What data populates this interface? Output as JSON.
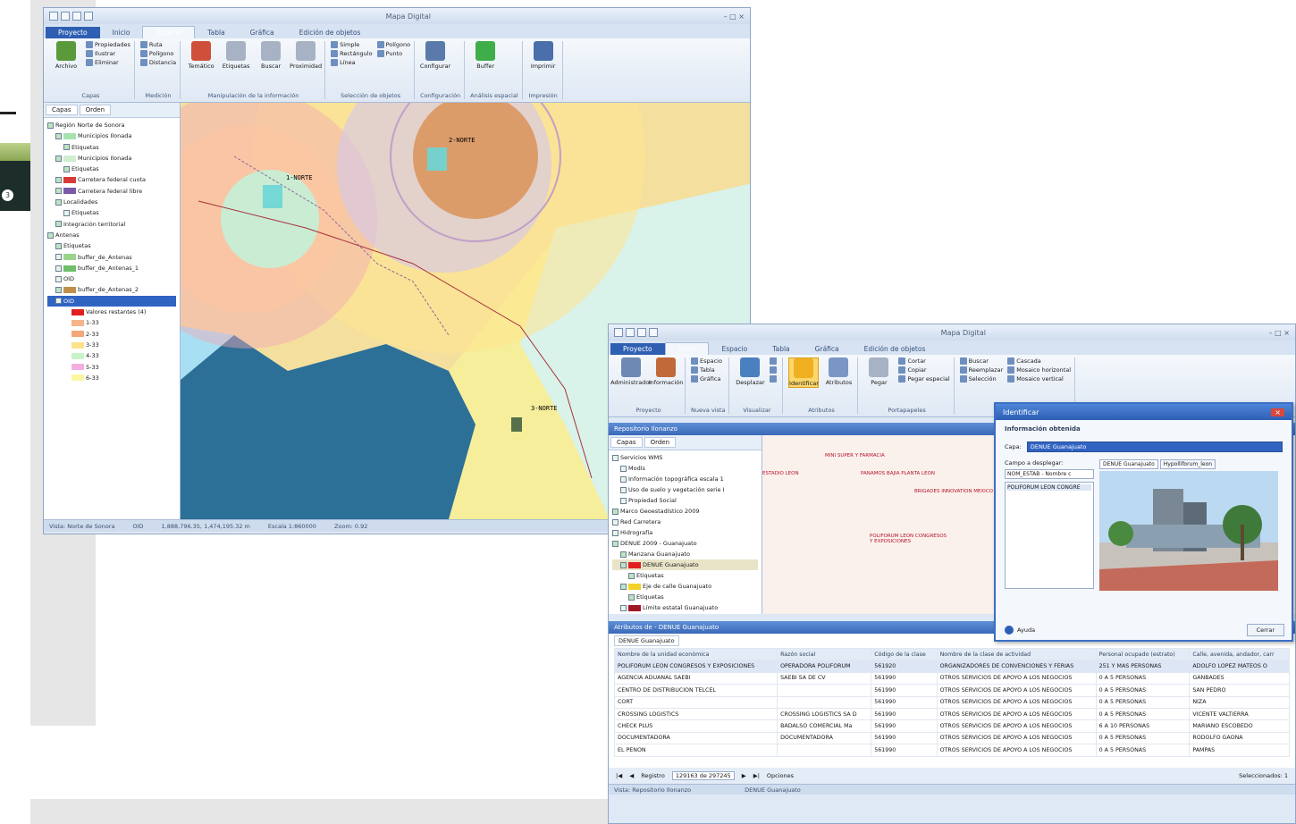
{
  "slide": {
    "badge": "3"
  },
  "win1": {
    "title": "Mapa Digital",
    "tabs": [
      "Proyecto",
      "Inicio",
      "Espacio",
      "Tabla",
      "Gráfica",
      "Edición de objetos"
    ],
    "groups": [
      {
        "label": "Capas",
        "items": [
          {
            "label": "Archivo",
            "kind": "big",
            "color": "#5a9a3a"
          },
          {
            "kind": "small",
            "list": [
              "Propiedades",
              "Ilustrar",
              "Eliminar"
            ]
          }
        ]
      },
      {
        "label": "Medición",
        "items": [
          {
            "kind": "small",
            "list": [
              "Ruta",
              "Polígono",
              "Distancia"
            ]
          }
        ]
      },
      {
        "label": "Manipulación de la información",
        "items": [
          {
            "label": "Temático",
            "kind": "big",
            "color": "#d04f3a"
          },
          {
            "label": "Etiquetas",
            "kind": "big",
            "color": "#a7b3c4"
          },
          {
            "label": "Buscar",
            "kind": "big",
            "color": "#a7b3c4"
          },
          {
            "label": "Proximidad",
            "kind": "big",
            "color": "#a7b3c4"
          }
        ]
      },
      {
        "label": "Selección de objetos",
        "items": [
          {
            "kind": "small",
            "list": [
              "Simple",
              "Rectángulo",
              "Línea"
            ]
          },
          {
            "kind": "small",
            "list": [
              "Polígono",
              "Punto"
            ]
          }
        ]
      },
      {
        "label": "Configuración",
        "items": [
          {
            "label": "Configurar",
            "kind": "big",
            "color": "#5a7aaa"
          }
        ]
      },
      {
        "label": "Análisis espacial",
        "items": [
          {
            "label": "Buffer",
            "kind": "big",
            "color": "#3fae4a"
          }
        ]
      },
      {
        "label": "Impresión",
        "items": [
          {
            "label": "Imprimir",
            "kind": "big",
            "color": "#4a6faa"
          }
        ]
      }
    ],
    "sidetabs": [
      "Capas",
      "Orden"
    ],
    "tree": [
      {
        "label": "Región Norte de Sonora",
        "indent": 0,
        "check": true
      },
      {
        "label": "Municipios Ilonada",
        "indent": 1,
        "check": true,
        "swatch": "#a7e3b0"
      },
      {
        "label": "Etiquetas",
        "indent": 2,
        "check": true
      },
      {
        "label": "Municipios Ilonada",
        "indent": 1,
        "check": true,
        "swatch": "#cfeed0"
      },
      {
        "label": "Etiquetas",
        "indent": 2,
        "check": true
      },
      {
        "label": "Carretera federal cuota",
        "indent": 1,
        "check": true,
        "swatch": "#d83a3a"
      },
      {
        "label": "Carretera federal libre",
        "indent": 1,
        "check": true,
        "swatch": "#7a5aa8"
      },
      {
        "label": "Localidades",
        "indent": 1,
        "check": true
      },
      {
        "label": "Etiquetas",
        "indent": 2,
        "check": false
      },
      {
        "label": "Integración territorial",
        "indent": 1,
        "check": true
      },
      {
        "label": "Antenas",
        "indent": 0,
        "check": true
      },
      {
        "label": "Etiquetas",
        "indent": 1,
        "check": true
      },
      {
        "label": "buffer_de_Antenas",
        "indent": 1,
        "check": false,
        "swatch": "#9bd48a"
      },
      {
        "label": "buffer_de_Antenas_1",
        "indent": 1,
        "check": false,
        "swatch": "#6fbf6a"
      },
      {
        "label": "OID",
        "indent": 1,
        "check": false
      },
      {
        "label": "buffer_de_Antenas_2",
        "indent": 1,
        "check": true,
        "swatch": "#c0904a"
      },
      {
        "label": "OID",
        "indent": 1,
        "check": false,
        "selected": true
      },
      {
        "label": "Valores restantes (4)",
        "indent": 3,
        "swatch": "#e02020"
      },
      {
        "label": "1-33",
        "indent": 3,
        "swatch": "#f7b38a"
      },
      {
        "label": "2-33",
        "indent": 3,
        "swatch": "#f4a87a"
      },
      {
        "label": "3-33",
        "indent": 3,
        "swatch": "#fde28a"
      },
      {
        "label": "4-33",
        "indent": 3,
        "swatch": "#c8f2c8"
      },
      {
        "label": "5-33",
        "indent": 3,
        "swatch": "#f2b0e0"
      },
      {
        "label": "6-33",
        "indent": 3,
        "swatch": "#fbf6a0"
      }
    ],
    "labels": [
      "1-NORTE",
      "2-NORTE",
      "3-NORTE"
    ],
    "status": [
      "Vista: Norte de Sonora",
      "OID",
      "1,888,796.35, 1,474,195.32 m",
      "Escala 1:860000",
      "Zoom: 0.92"
    ]
  },
  "win2": {
    "title": "Mapa Digital",
    "tabs": [
      "Proyecto",
      "Inicio",
      "Espacio",
      "Tabla",
      "Gráfica",
      "Edición de objetos"
    ],
    "groups": [
      {
        "label": "Proyecto",
        "items": [
          {
            "label": "Administrador",
            "kind": "big",
            "color": "#6f89b5"
          },
          {
            "label": "Información",
            "kind": "big",
            "color": "#c06a3a"
          }
        ]
      },
      {
        "label": "Nueva vista",
        "items": [
          {
            "kind": "small",
            "list": [
              "Espacio",
              "Tabla",
              "Gráfica"
            ]
          }
        ]
      },
      {
        "label": "Visualizar",
        "items": [
          {
            "label": "Desplazar",
            "kind": "big",
            "color": "#4a7fc0"
          },
          {
            "kind": "small",
            "list": [
              "",
              "",
              ""
            ]
          }
        ]
      },
      {
        "label": "Atributos",
        "items": [
          {
            "label": "Identificar",
            "kind": "big",
            "color": "#f0b020",
            "active": true
          },
          {
            "label": "Atributos",
            "kind": "big",
            "color": "#7a96c4"
          }
        ]
      },
      {
        "label": "Portapapeles",
        "items": [
          {
            "label": "Pegar",
            "kind": "big",
            "color": "#a7b3c4"
          },
          {
            "kind": "small",
            "list": [
              "Cortar",
              "Copiar",
              "Pegar especial"
            ]
          }
        ]
      },
      {
        "label": "",
        "items": [
          {
            "kind": "small",
            "list": [
              "Buscar",
              "Reemplazar",
              "Selección"
            ]
          },
          {
            "kind": "small",
            "list": [
              "Cascada",
              "Mosaico horizontal",
              "Mosaico vertical"
            ]
          }
        ]
      }
    ],
    "panel_title": "Repositorio Ilonanzo",
    "sidetabs": [
      "Capas",
      "Orden"
    ],
    "tree": [
      {
        "label": "Servicios WMS",
        "indent": 0,
        "check": false
      },
      {
        "label": "Modis",
        "indent": 1,
        "check": false
      },
      {
        "label": "Información topográfica escala 1",
        "indent": 1,
        "check": false
      },
      {
        "label": "Uso de suelo y vegetación serie I",
        "indent": 1,
        "check": false
      },
      {
        "label": "Propiedad Social",
        "indent": 1,
        "check": false
      },
      {
        "label": "Marco Geoestadístico 2009",
        "indent": 0,
        "check": true
      },
      {
        "label": "Red Carretera",
        "indent": 0,
        "check": false
      },
      {
        "label": "Hidrografía",
        "indent": 0,
        "check": false
      },
      {
        "label": "DENUE 2009 - Guanajuato",
        "indent": 0,
        "check": true
      },
      {
        "label": "Manzana Guanajuato",
        "indent": 1,
        "check": true
      },
      {
        "label": "DENUE Guanajuato",
        "indent": 1,
        "check": true,
        "swatch": "#e02020",
        "hl": true
      },
      {
        "label": "Etiquetas",
        "indent": 2,
        "check": true
      },
      {
        "label": "Eje de calle Guanajuato",
        "indent": 1,
        "check": true,
        "swatch": "#f2d12a"
      },
      {
        "label": "Etiquetas",
        "indent": 2,
        "check": true
      },
      {
        "label": "Límite estatal Guanajuato",
        "indent": 1,
        "check": false,
        "swatch": "#a01828"
      }
    ],
    "map_labels": [
      "MINI SUPER Y FARMACIA",
      "ESTADIO LEON",
      "PANAMOS BAJIA PLANTA LEON",
      "BRIGADES INNOVATION MEXICO",
      "POLIFORUM LEON CONGRESOS Y EXPOSICIONES"
    ],
    "attr_title": "Atributos de - DENUE Guanajuato",
    "attr_tab": "DENUE Guanajuato",
    "columns": [
      "Nombre de la unidad económica",
      "Razón social",
      "Código de la clase",
      "Nombre de la clase de actividad",
      "Personal ocupado (estrato)",
      "Calle, avenida, andador, carr"
    ],
    "rows": [
      [
        "POLIFORUM LEON CONGRESOS Y EXPOSICIONES",
        "OPERADORA POLIFORUM",
        "561920",
        "ORGANIZADORES DE CONVENCIONES Y FERIAS",
        "251 Y MAS PERSONAS",
        "ADOLFO LOPEZ MATEOS O"
      ],
      [
        "AGENCIA ADUANAL SAEBI",
        "SAEBI SA DE CV",
        "561990",
        "OTROS SERVICIOS DE APOYO A LOS NEGOCIOS",
        "0 A 5 PERSONAS",
        "GANBADES"
      ],
      [
        "CENTRO DE DISTRIBUCION TELCEL",
        "",
        "561990",
        "OTROS SERVICIOS DE APOYO A LOS NEGOCIOS",
        "0 A 5 PERSONAS",
        "SAN PEDRO"
      ],
      [
        "CORT",
        "",
        "561990",
        "OTROS SERVICIOS DE APOYO A LOS NEGOCIOS",
        "0 A 5 PERSONAS",
        "NIZA"
      ],
      [
        "CROSSING LOGISTICS",
        "CROSSING LOGISTICS SA D",
        "561990",
        "OTROS SERVICIOS DE APOYO A LOS NEGOCIOS",
        "0 A 5 PERSONAS",
        "VICENTE VALTIERRA"
      ],
      [
        "CHECK PLUS",
        "BADALSO COMERCIAL Ma",
        "561990",
        "OTROS SERVICIOS DE APOYO A LOS NEGOCIOS",
        "6 A 10 PERSONAS",
        "MARIANO ESCOBEDO"
      ],
      [
        "DOCUMENTADORA",
        "DOCUMENTADORA",
        "561990",
        "OTROS SERVICIOS DE APOYO A LOS NEGOCIOS",
        "0 A 5 PERSONAS",
        "RODOLFO GAONA"
      ],
      [
        "EL PENON",
        "",
        "561990",
        "OTROS SERVICIOS DE APOYO A LOS NEGOCIOS",
        "0 A 5 PERSONAS",
        "PAMPAS"
      ]
    ],
    "nav": {
      "label": "Registro",
      "record": "129163 de 297245",
      "options": "Opciones",
      "selected": "Seleccionados: 1"
    },
    "status": [
      "Vista: Repositorio Ilonanzo",
      "DENUE Guanajuato"
    ]
  },
  "identify": {
    "title": "Identificar",
    "heading": "Información obtenida",
    "capa_label": "Capa:",
    "capa_value": "DENUE Guanajuato",
    "campo_label": "Campo a desplegar:",
    "campo_value": "NOM_ESTAB - Nombre c",
    "result": "POLIFORUM LEON CONGRE",
    "tabs": [
      "DENUE Guanajuato",
      "Hypolliforum_leon"
    ],
    "help": "Ayuda",
    "close": "Cerrar"
  }
}
